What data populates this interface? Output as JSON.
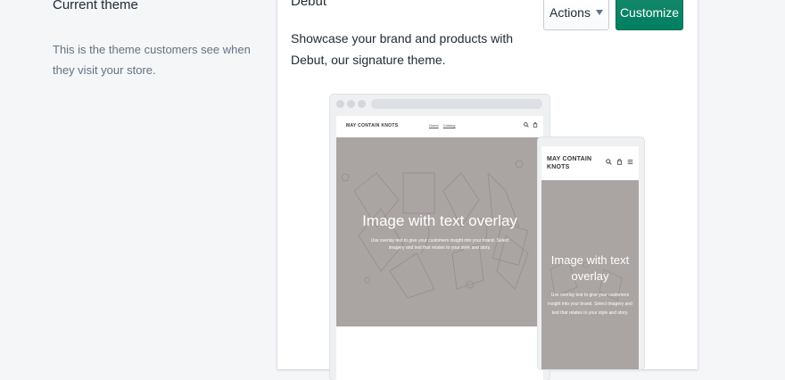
{
  "annotation": {
    "title": "Current theme",
    "description": "This is the theme customers see when they visit your store."
  },
  "theme": {
    "name": "Debut",
    "description": "Showcase your brand and products with Debut, our signature theme."
  },
  "buttons": {
    "actions_label": "Actions",
    "customize_label": "Customize"
  },
  "colors": {
    "customize_button": "#008060",
    "hero_background": "#aaa4a3",
    "page_background": "#f4f6f8"
  },
  "preview": {
    "store_name": "MAY CONTAIN KNOTS",
    "nav": [
      "Home",
      "Catalog"
    ],
    "hero_title": "Image with text overlay",
    "hero_text": "Use overlay text to give your customers insight into your brand. Select imagery and text that relates to your style and story.",
    "desktop_icons": [
      "search-icon",
      "cart-icon"
    ],
    "mobile_icons": [
      "search-icon",
      "cart-icon",
      "menu-icon"
    ]
  }
}
